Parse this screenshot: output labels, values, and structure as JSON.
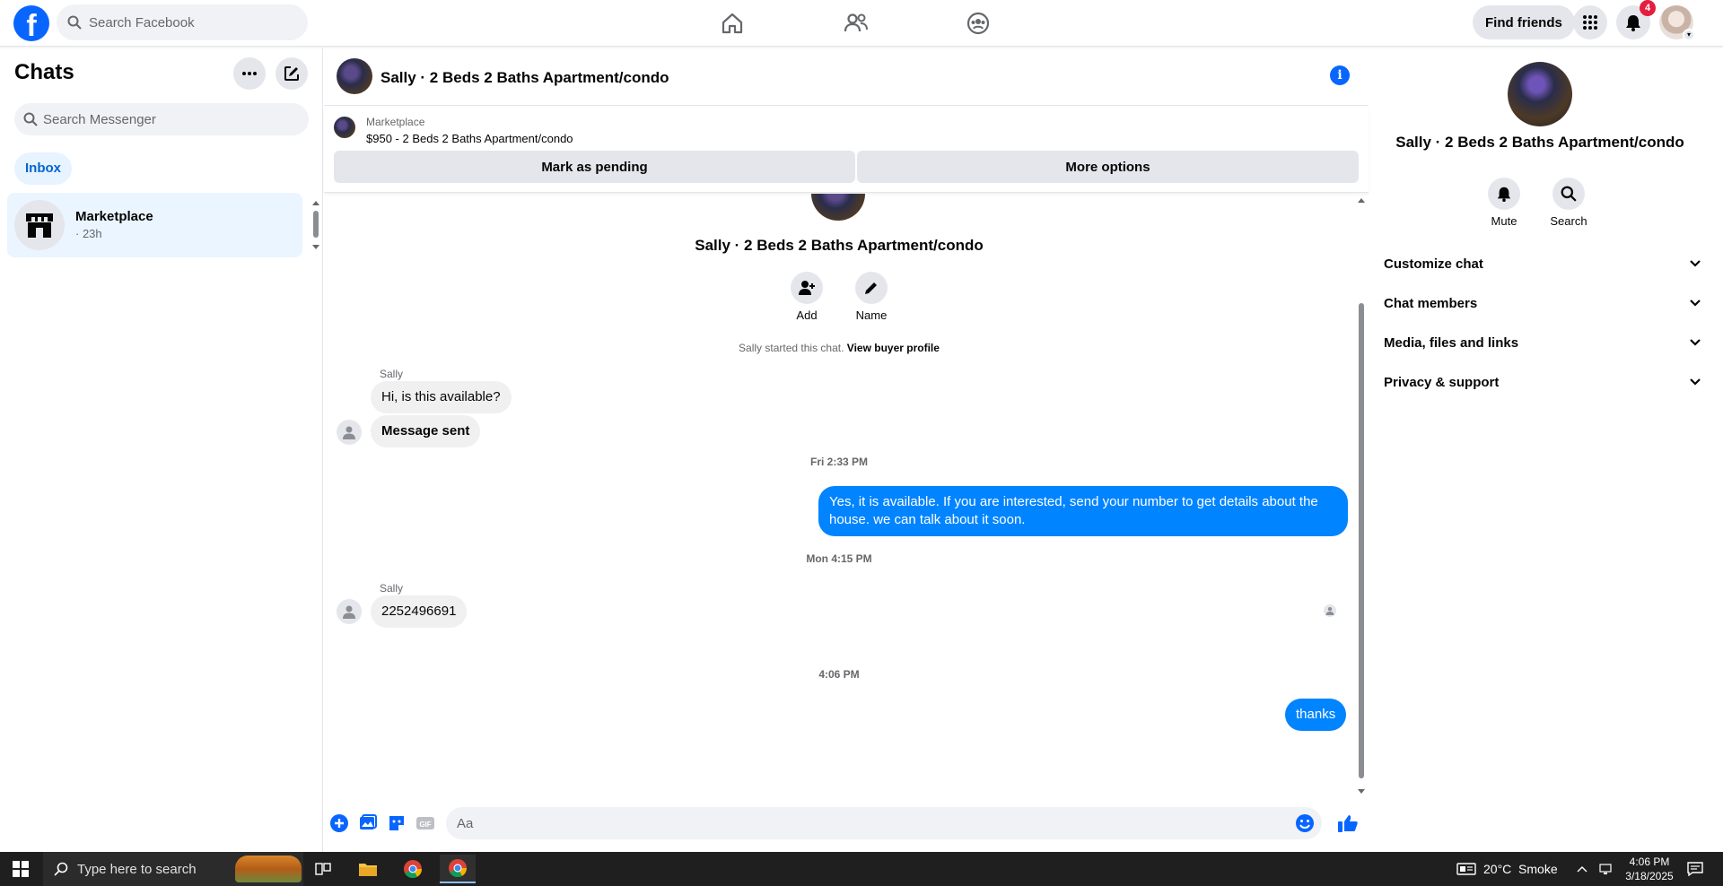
{
  "topbar": {
    "logo_glyph": "f",
    "search_placeholder": "Search Facebook",
    "nav_icons": [
      "home-icon",
      "friends-icon",
      "groups-icon"
    ],
    "find_friends_label": "Find friends",
    "notifications_count": "4"
  },
  "sidebar": {
    "title": "Chats",
    "search_placeholder": "Search Messenger",
    "tab_label": "Inbox",
    "chats": [
      {
        "name": "Marketplace",
        "time": "· 23h"
      }
    ]
  },
  "conversation": {
    "title": "Sally · 2 Beds 2 Baths Apartment/condo",
    "marketplace_label": "Marketplace",
    "listing": "$950 - 2 Beds 2 Baths Apartment/condo",
    "mark_pending_label": "Mark as pending",
    "more_options_label": "More options",
    "hero_name": "Sally · 2 Beds 2 Baths Apartment/condo",
    "add_label": "Add",
    "name_label": "Name",
    "started_text": "Sally started this chat.",
    "view_profile_link": "View buyer profile",
    "messages": [
      {
        "sender": "Sally",
        "text": "Hi, is this available?"
      },
      {
        "text": "Message sent"
      },
      {
        "timestamp": "Fri 2:33 PM"
      },
      {
        "text": "Yes, it is available. If you are interested, send your number to get details about the house. we can talk about it soon."
      },
      {
        "timestamp": "Mon 4:15 PM"
      },
      {
        "sender": "Sally",
        "text": "2252496691"
      },
      {
        "timestamp": "4:06 PM"
      },
      {
        "text": "thanks"
      }
    ],
    "composer_placeholder": "Aa"
  },
  "info_panel": {
    "name": "Sally · 2 Beds 2 Baths Apartment/condo",
    "mute_label": "Mute",
    "search_label": "Search",
    "sections": [
      "Customize chat",
      "Chat members",
      "Media, files and links",
      "Privacy & support"
    ]
  },
  "taskbar": {
    "search_placeholder": "Type here to search",
    "weather": "20°C  Smoke",
    "time": "4:06 PM",
    "date": "3/18/2025"
  },
  "colors": {
    "facebook_blue": "#0866ff",
    "messenger_blue": "#0084ff",
    "selected_chat_bg": "#ebf5ff",
    "badge_red": "#e41e3f"
  }
}
